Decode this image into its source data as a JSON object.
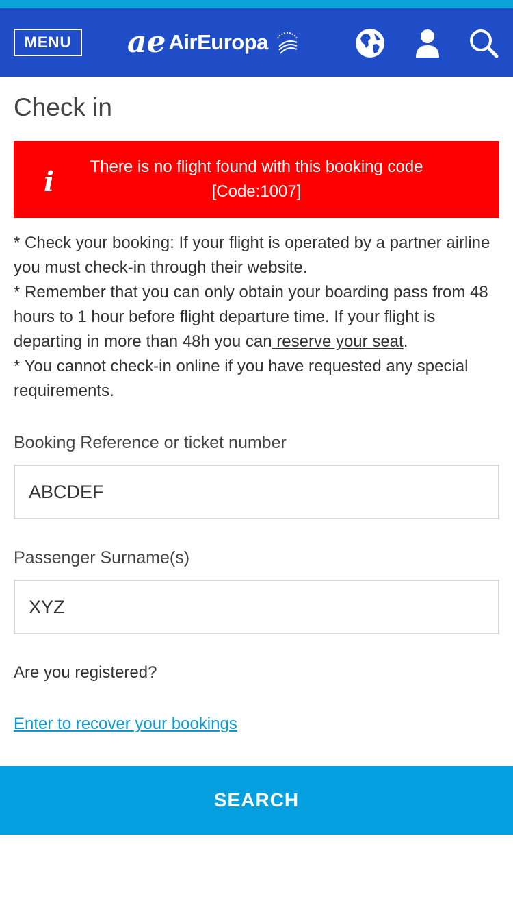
{
  "header": {
    "menu_label": "MENU",
    "brand_mark": "ae",
    "brand_name": "AirEuropa",
    "icons": [
      "globe-icon",
      "user-icon",
      "search-icon"
    ],
    "colors": {
      "navbar": "#1e4dc7",
      "top_strip": "#0aa3d9"
    }
  },
  "page": {
    "title": "Check in"
  },
  "alert": {
    "icon": "info-icon",
    "line1": "There is no flight found with this booking code",
    "line2": "[Code:1007]",
    "color": "#ff0000"
  },
  "info": {
    "p1": "* Check your booking: If your flight is operated by a partner airline you must check-in through their website.",
    "p2_before": "* Remember that you can only obtain your boarding pass from 48 hours to 1 hour before flight departure time. If your flight is departing in more than 48h you can",
    "p2_link": " reserve your seat",
    "p2_after": ".",
    "p3": "* You cannot check-in online if you have requested any special requirements."
  },
  "form": {
    "booking_label": "Booking Reference or ticket number",
    "booking_value": "ABCDEF",
    "surname_label": "Passenger Surname(s)",
    "surname_value": "XYZ",
    "registered_text": "Are you registered?",
    "recover_link": "Enter to recover your bookings",
    "search_label": "SEARCH",
    "colors": {
      "search_button": "#049fdf",
      "link": "#0a9ad6"
    }
  }
}
